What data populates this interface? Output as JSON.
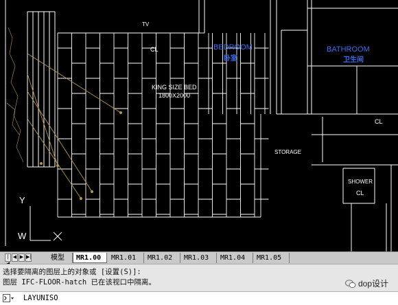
{
  "drawing": {
    "labels": {
      "tv": "TV",
      "cl_1": "CL",
      "cl_2": "CL",
      "cl_3": "CL",
      "bedroom_en": "BEDROOM",
      "bedroom_cn": "卧室",
      "bathroom_en": "BATHROOM",
      "bathroom_cn": "卫生间",
      "bed_name": "KING SIZE BED",
      "bed_size": "1800X2000",
      "storage": "STORAGE",
      "shower": "SHOWER"
    },
    "ucs": {
      "y_label": "Y",
      "w_label": "W"
    },
    "colors": {
      "background": "#000000",
      "lines": "#ffffff",
      "room_text_blue": "#3a6df0",
      "leader": "#b59a4a"
    }
  },
  "tabbar": {
    "nav": [
      "|◀",
      "◀",
      "▶",
      "▶|"
    ],
    "tabs": [
      {
        "label": "模型",
        "active": false
      },
      {
        "label": "MR1.00",
        "active": true
      },
      {
        "label": "MR1.01",
        "active": false
      },
      {
        "label": "MR1.02",
        "active": false
      },
      {
        "label": "MR1.03",
        "active": false
      },
      {
        "label": "MR1.04",
        "active": false
      },
      {
        "label": "MR1.05",
        "active": false
      }
    ]
  },
  "command_history": [
    "选择要隔离的图层上的对象或 [设置(S)]:",
    "图层 IFC-FLOOR-hatch 已在该视口中隔离。"
  ],
  "command_line": {
    "value": "LAYUNISO"
  },
  "watermark": {
    "text": "dop设计"
  }
}
